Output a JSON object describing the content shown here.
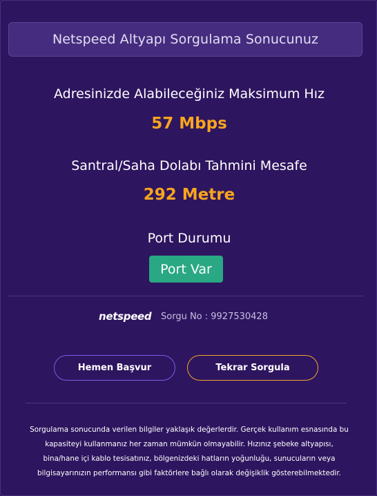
{
  "header": {
    "title": "Netspeed Altyapı Sorgulama Sonucunuz"
  },
  "speed": {
    "label": "Adresinizde Alabileceğiniz Maksimum Hız",
    "value": "57 Mbps"
  },
  "distance": {
    "label": "Santral/Saha Dolabı Tahmini Mesafe",
    "value": "292 Metre"
  },
  "port": {
    "label": "Port Durumu",
    "status": "Port Var"
  },
  "footer": {
    "logo": "netspeed",
    "query_number": "Sorgu No : 9927530428"
  },
  "actions": {
    "apply_label": "Hemen Başvur",
    "requery_label": "Tekrar Sorgula"
  },
  "disclaimer": {
    "line1": "Sorgulama sonucunda verilen bilgiler yaklaşık değerlerdir. Gerçek kullanım esnasında bu",
    "line2": "kapasiteyi kullanmanız her zaman mümkün olmayabilir. Hızınız şebeke altyapısı,",
    "line3": "bina/hane içi kablo tesisatınız, bölgenizdeki hatların yoğunluğu, sunucuların veya",
    "line4": "bilgisayarınızın performansı gibi faktörlere bağlı olarak değişiklik gösterebilmektedir."
  },
  "colors": {
    "background": "#2e155f",
    "accent_orange": "#f7a51e",
    "port_green": "#29a883",
    "button_purple": "#7c5ce6"
  }
}
